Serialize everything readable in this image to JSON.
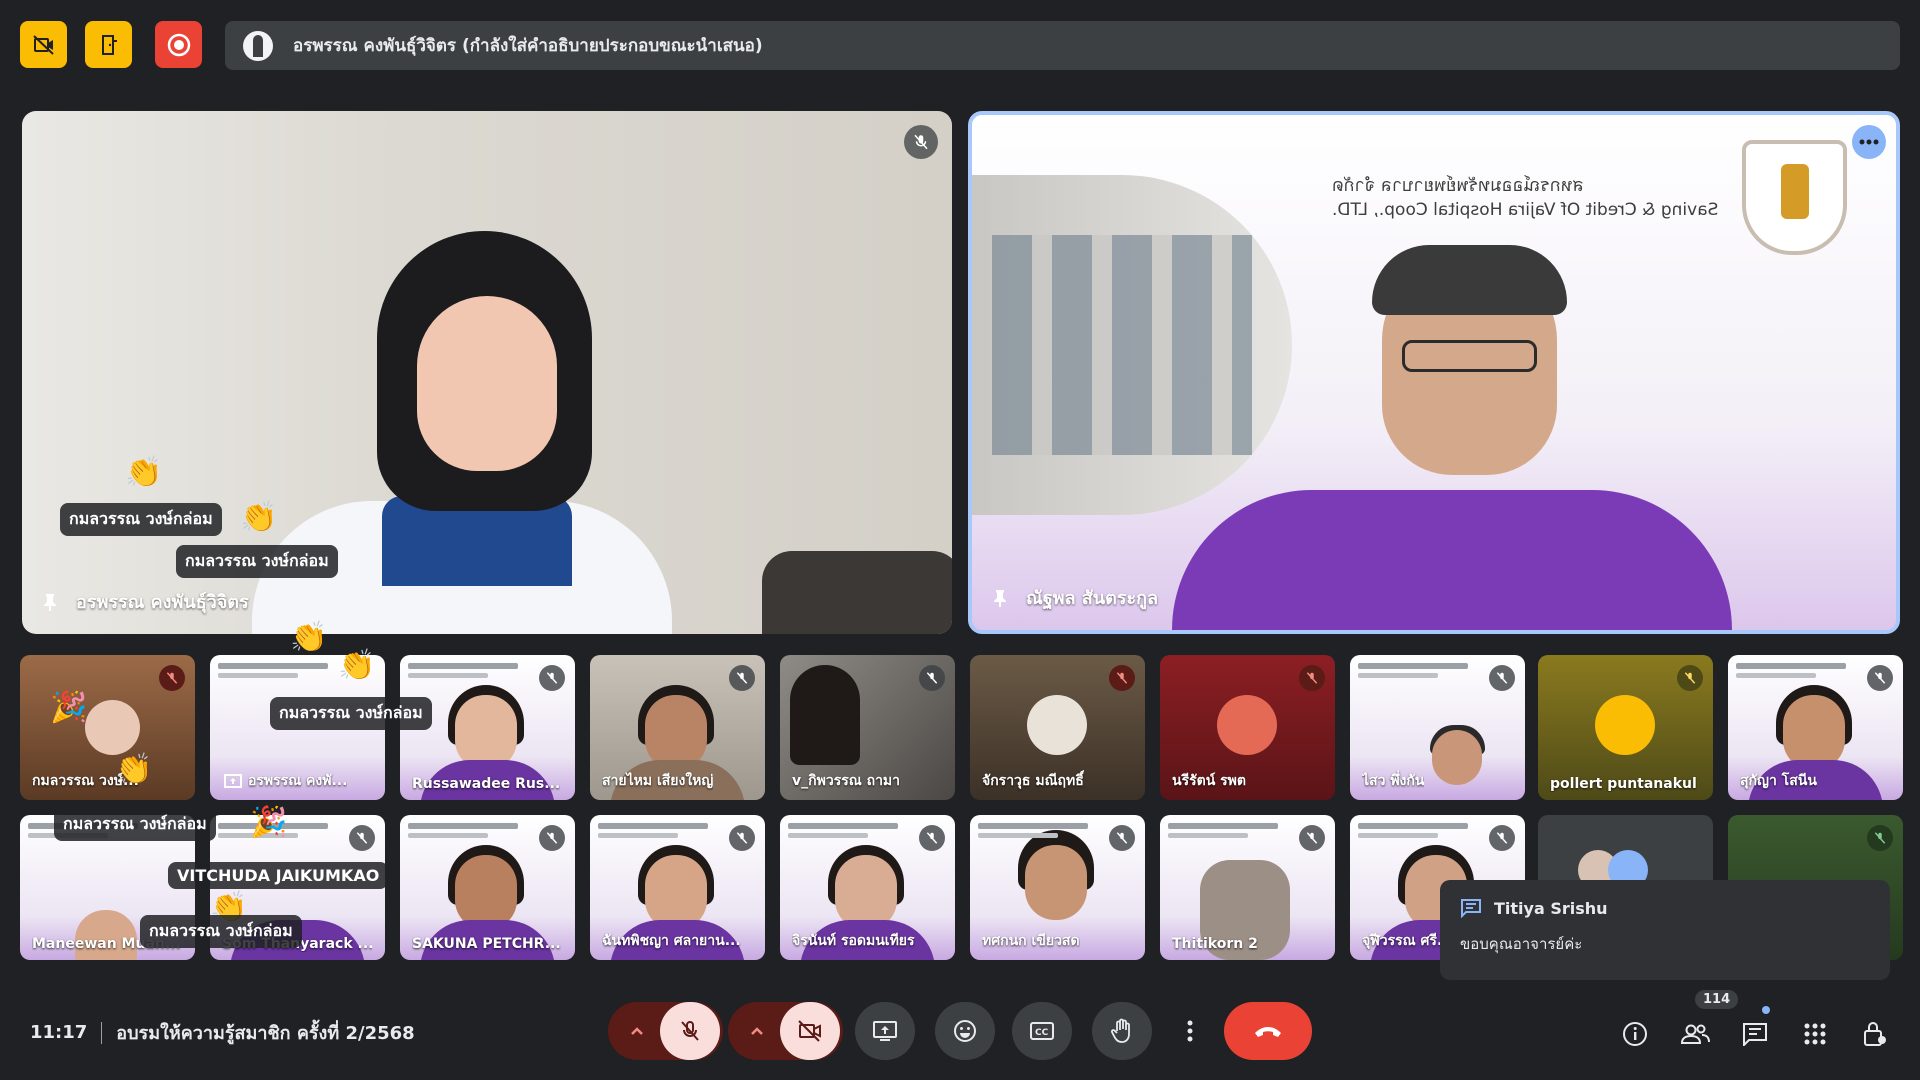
{
  "top": {
    "caption_text": "อรพรรณ คงพันธุ์วิจิตร (กำลังใส่คำอธิบายประกอบขณะนำเสนอ)"
  },
  "main": {
    "left": {
      "name": "อรพรรณ คงพันธุ์วิจิตร"
    },
    "right": {
      "name": "ณัฐพล สันตระกูล",
      "slide_line1": "สหกรณ์ออมทรัพย์พยาบาล จำกัด",
      "slide_line2": "Saving & Credit Of Vajira Hospital Coop., LTD."
    }
  },
  "reactions": {
    "label_1": "กมลวรรณ วงษ์กล่อม",
    "label_2": "กมลวรรณ วงษ์กล่อม",
    "label_3": "กมลวรรณ วงษ์กล่อม",
    "label_4": "กมลวรรณ วงษ์กล่อม",
    "label_5": "VITCHUDA JAIKUMKAO",
    "label_6": "กมลวรรณ วงษ์กล่อม"
  },
  "tiles_row1": [
    {
      "name": "กมลวรรณ วงษ์..."
    },
    {
      "name": "อรพรรณ คงพั..."
    },
    {
      "name": "Russawadee Rus..."
    },
    {
      "name": "สายไหม เสียงใหญ่"
    },
    {
      "name": "v_กิพวรรณ ถามา"
    },
    {
      "name": "จักราวุธ มณีฤทธิ์"
    },
    {
      "name": "นรีรัตน์ รพต"
    },
    {
      "name": "ไสว พึ่งกัน"
    },
    {
      "name": "pollert puntanakul"
    },
    {
      "name": "สุกัญา โสนีน"
    }
  ],
  "tiles_row2": [
    {
      "name": "Maneewan Muan..."
    },
    {
      "name": "Som Thanyarack ..."
    },
    {
      "name": "SAKUNA PETCHR..."
    },
    {
      "name": "ฉันทพิชญา ศลายาน..."
    },
    {
      "name": "จิรนันท์ รอดมนเทียร"
    },
    {
      "name": "ทศกนก เขียวสด"
    },
    {
      "name": "Thitikorn 2"
    },
    {
      "name": "จุฬีวรรณ ศรี..."
    }
  ],
  "toast": {
    "sender": "Titiya Srishu",
    "message": "ขอบคุณอาจารย์ค่ะ"
  },
  "bottom": {
    "time": "11:17",
    "meeting_title": "อบรมให้ความรู้สมาชิก ครั้งที่ 2/2568",
    "participant_count": "114"
  },
  "colors": {
    "background": "#202124",
    "accent_yellow": "#fbbc04",
    "record_red": "#ea4335",
    "end_call_red": "#ea4335",
    "highlight_blue": "#8ab4f8",
    "slide_purple": "#7b3bb6"
  }
}
